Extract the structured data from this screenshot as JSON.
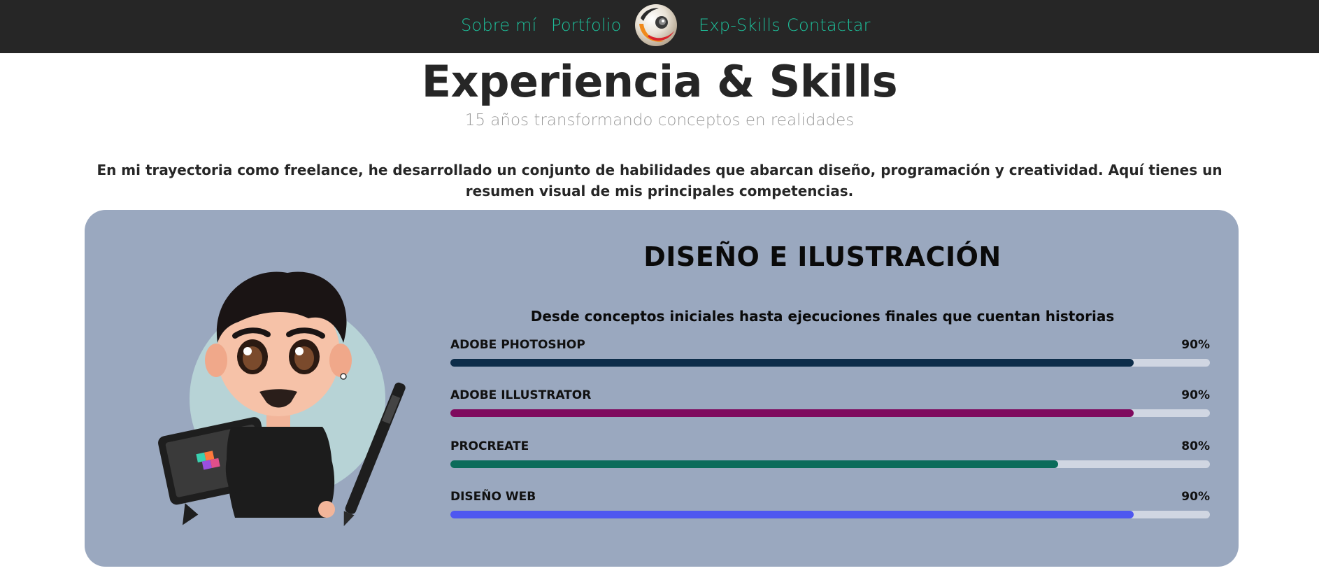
{
  "nav": {
    "items": [
      {
        "id": "nav-sobre",
        "label": "Sobre mí"
      },
      {
        "id": "nav-portfolio",
        "label": "Portfolio"
      },
      {
        "id": "nav-exp",
        "label": "Exp-Skills"
      },
      {
        "id": "nav-contactar",
        "label": "Contactar"
      }
    ],
    "logo_icon": "brand-logo-icon",
    "link_color": "#1dbf9a",
    "background": "#262626"
  },
  "header": {
    "title": "Experiencia & Skills",
    "subtitle": "15 años transformando conceptos en realidades"
  },
  "intro": {
    "text": "En mi trayectoria como freelance, he desarrollado un conjunto de habilidades que abarcan diseño, programación y creatividad. Aquí tienes un resumen visual de mis principales competencias."
  },
  "card": {
    "title": "DISEÑO E ILUSTRACIÓN",
    "subtitle": "Desde conceptos iniciales hasta ejecuciones finales que cuentan historias",
    "background": "#9aa8bf",
    "avatar_icon": "cartoon-avatar-illustration",
    "skills": [
      {
        "name": "ADOBE PHOTOSHOP",
        "percent_label": "90%",
        "level": 0.9,
        "color": "#0d2d4a"
      },
      {
        "name": "ADOBE ILLUSTRATOR",
        "percent_label": "90%",
        "level": 0.9,
        "color": "#7f0a5e"
      },
      {
        "name": "PROCREATE",
        "percent_label": "80%",
        "level": 0.8,
        "color": "#0b6b5a"
      },
      {
        "name": "DISEÑO WEB",
        "percent_label": "90%",
        "level": 0.9,
        "color": "#4e57f0"
      }
    ]
  }
}
